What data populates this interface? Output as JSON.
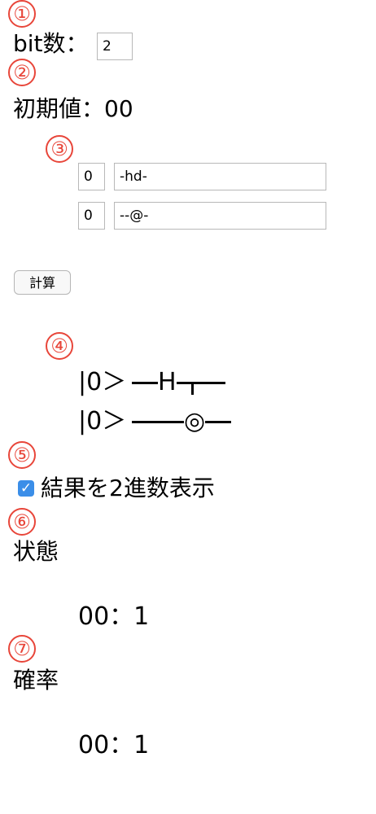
{
  "markers": [
    "①",
    "②",
    "③",
    "④",
    "⑤",
    "⑥",
    "⑦"
  ],
  "bits": {
    "label": "bit数：",
    "value": "2"
  },
  "initial": {
    "label": "初期値：",
    "value": "00"
  },
  "gates": [
    {
      "init": "0",
      "spec": "-hd-"
    },
    {
      "init": "0",
      "spec": "--@-"
    }
  ],
  "calc_button": "計算",
  "circuit": [
    {
      "ket": "|0＞",
      "gate": "H"
    },
    {
      "ket": "|0＞",
      "gate": "◎"
    }
  ],
  "binary_display": {
    "checked": true,
    "label": "結果を2進数表示"
  },
  "state": {
    "heading": "状態",
    "result": "00：1"
  },
  "probability": {
    "heading": "確率",
    "result": "00：1"
  }
}
